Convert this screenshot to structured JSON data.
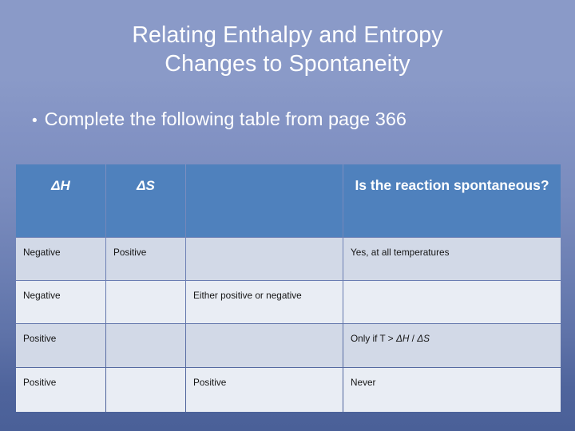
{
  "slide": {
    "title": "Relating Enthalpy and Entropy\nChanges to Spontaneity",
    "bullet_glyph": "•",
    "bullet_text": "Complete the following table from page 366",
    "background_top_color": "#8a9ac8",
    "background_bottom_color": "#4a6098"
  },
  "table": {
    "header_bg_color": "#4f81bd",
    "header_text_color": "#ffffff",
    "row_band_dark_color": "#d2d9e7",
    "row_band_light_color": "#e9edf4",
    "gridline_color": "#ffffff",
    "headers": [
      {
        "label": "ΔH",
        "italic": true
      },
      {
        "label": "ΔS",
        "italic": true
      },
      {
        "label": "",
        "italic": false
      },
      {
        "label": "Is the reaction spontaneous?",
        "italic": false
      }
    ],
    "rows": [
      {
        "band": "dark",
        "cells": [
          "Negative",
          "Positive",
          "",
          "Yes, at all temperatures"
        ]
      },
      {
        "band": "light",
        "cells": [
          "Negative",
          "",
          "Either positive or negative",
          ""
        ]
      },
      {
        "band": "dark",
        "cells": [
          "Positive",
          "",
          "",
          "Only if T > ΔH / ΔS"
        ]
      },
      {
        "band": "light",
        "cells": [
          "Positive",
          "",
          "Positive",
          "Never"
        ]
      }
    ]
  }
}
